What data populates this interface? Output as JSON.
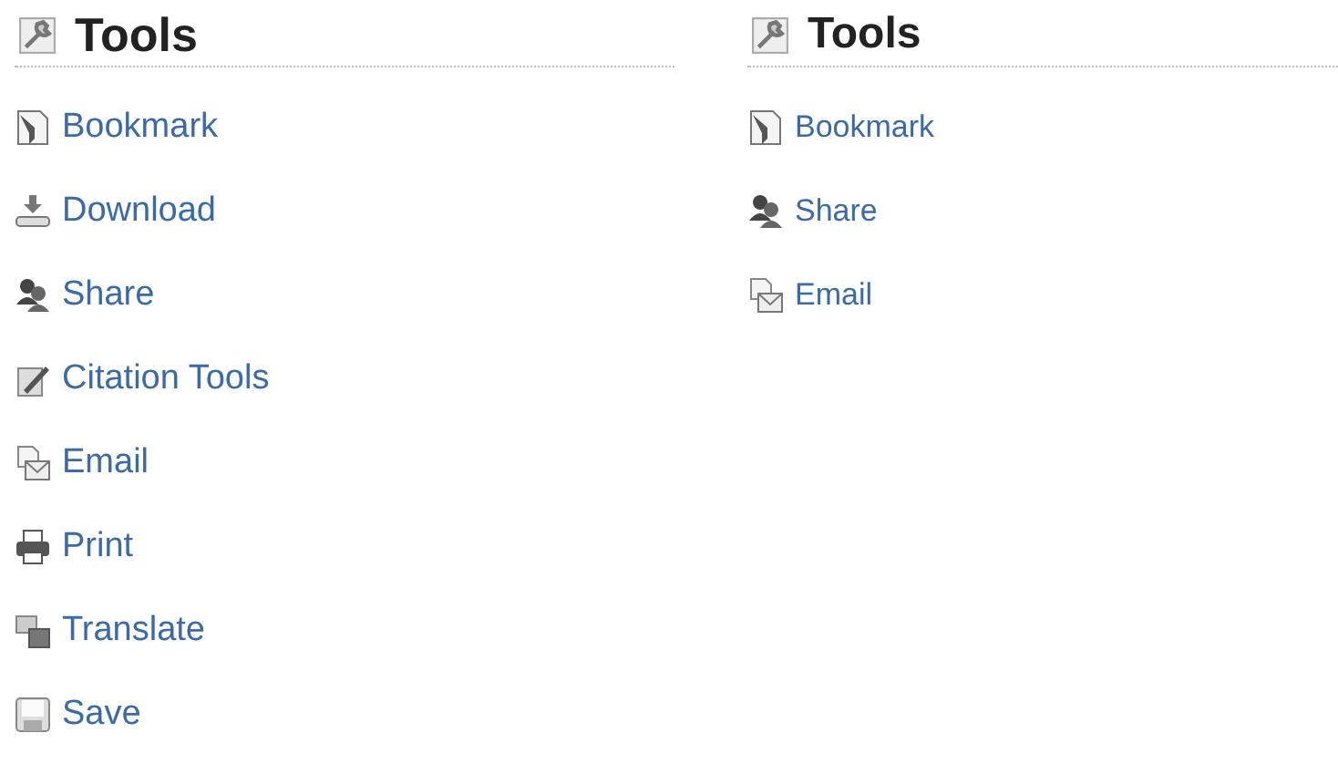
{
  "panels": [
    {
      "title": "Tools",
      "items": [
        {
          "kind": "bookmark",
          "label": "Bookmark"
        },
        {
          "kind": "download",
          "label": "Download"
        },
        {
          "kind": "share",
          "label": "Share"
        },
        {
          "kind": "citation",
          "label": "Citation Tools"
        },
        {
          "kind": "email",
          "label": "Email"
        },
        {
          "kind": "print",
          "label": "Print"
        },
        {
          "kind": "translate",
          "label": "Translate"
        },
        {
          "kind": "save",
          "label": "Save"
        }
      ]
    },
    {
      "title": "Tools",
      "items": [
        {
          "kind": "bookmark",
          "label": "Bookmark"
        },
        {
          "kind": "share",
          "label": "Share"
        },
        {
          "kind": "email",
          "label": "Email"
        }
      ]
    }
  ]
}
